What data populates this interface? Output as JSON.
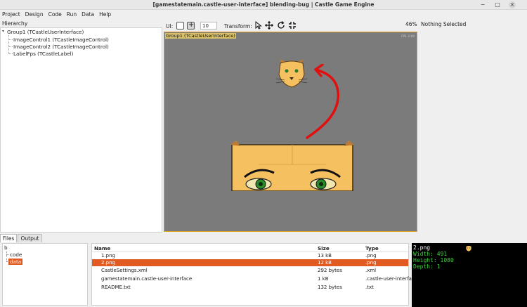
{
  "window": {
    "title": "[gamestatemain.castle-user-interface] blending-bug | Castle Game Engine",
    "minimize": "−",
    "maximize": "□",
    "close": "×"
  },
  "menu": [
    "Project",
    "Design",
    "Code",
    "Run",
    "Data",
    "Help"
  ],
  "hierarchy": {
    "label": "Hierarchy",
    "items": [
      "Group1 (TCastleUserInterface)",
      "ImageControl1 (TCastleImageControl)",
      "ImageControl2 (TCastleImageControl)",
      "LabelFps (TCastleLabel)"
    ]
  },
  "toolbar": {
    "ui_label": "UI:",
    "spin_value": "10",
    "transform_label": "Transform:",
    "icons": [
      "select-arrow-icon",
      "move-icon",
      "rotate-icon",
      "scale-icon"
    ]
  },
  "status": {
    "zoom": "46%",
    "selection": "Nothing Selected"
  },
  "viewport": {
    "group_label": "Group1 (TCastleUserInterface)",
    "fps_label": "FPS: 0.00"
  },
  "colors": {
    "accent": "#e05a22",
    "viewport_bg": "#7b7b7b",
    "preview_text": "#3dd13d",
    "arrow": "#e01010",
    "cat_fur": "#f5c060"
  },
  "bottom_tabs": [
    {
      "label": "Files",
      "active": true
    },
    {
      "label": "Output",
      "active": false
    }
  ],
  "files_tree": {
    "root": "b",
    "children": [
      "code",
      "data"
    ],
    "selected": "data"
  },
  "files": {
    "columns": [
      "Name",
      "Size",
      "Type"
    ],
    "rows": [
      {
        "name": "1.png",
        "size": "13 kB",
        "type": ".png",
        "selected": false
      },
      {
        "name": "2.png",
        "size": "12 kB",
        "type": ".png",
        "selected": true
      },
      {
        "name": "CastleSettings.xml",
        "size": "292 bytes",
        "type": ".xml",
        "selected": false
      },
      {
        "name": "gamestatemain.castle-user-interface",
        "size": "1 kB",
        "type": ".castle-user-interfa",
        "selected": false
      },
      {
        "name": "README.txt",
        "size": "132 bytes",
        "type": ".txt",
        "selected": false
      }
    ]
  },
  "preview": {
    "file": "2.png",
    "width": "Width: 491",
    "height": "Height: 1080",
    "depth": "Depth: 1"
  }
}
